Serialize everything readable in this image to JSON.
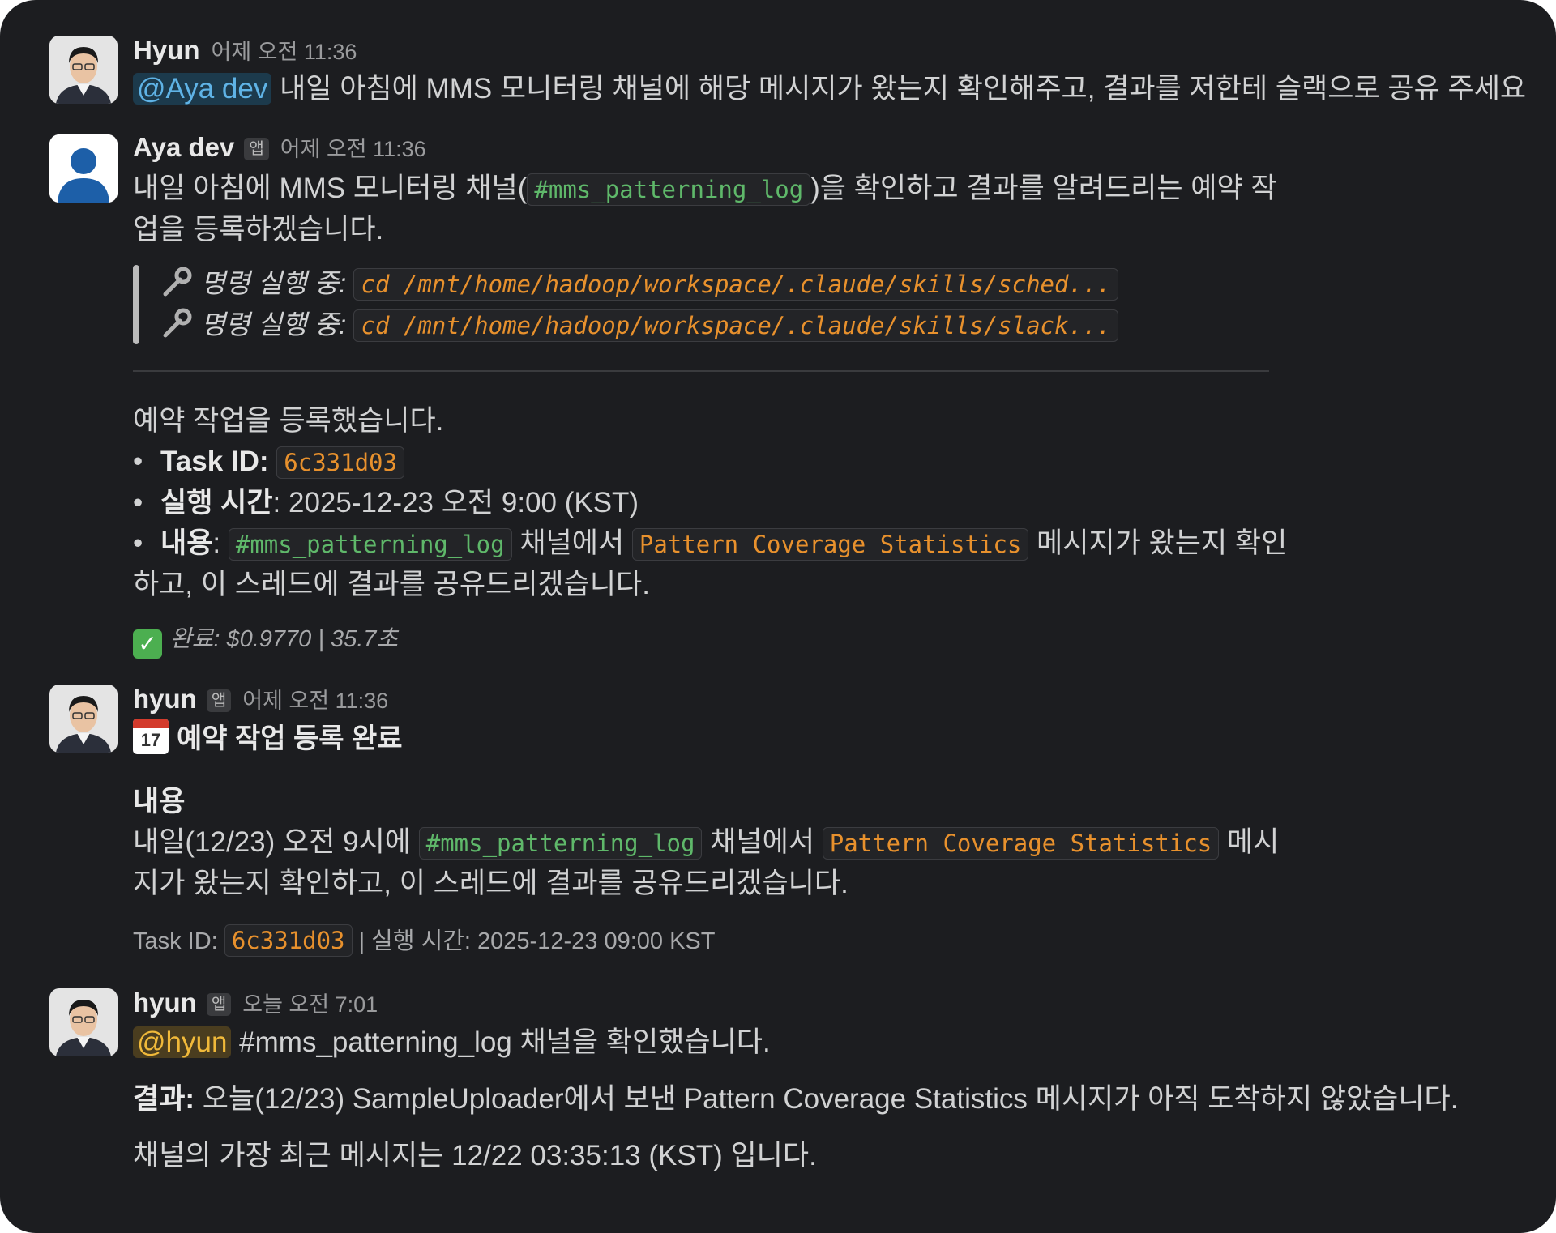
{
  "colors": {
    "background": "#1c1d20",
    "mention_bg": "#1c3a4c",
    "mention_text": "#5fb3e6",
    "code_text": "#e8912d",
    "channel_code_text": "#5fb86a",
    "self_mention_text": "#f0b93a"
  },
  "messages": [
    {
      "user": "Hyun",
      "time": "어제 오전 11:36",
      "avatar": "person-photo",
      "mention": "@Aya dev",
      "text": "내일 아침에 MMS 모니터링 채널에 해당 메시지가 왔는지 확인해주고, 결과를 저한테 슬랙으로 공유 주세요"
    },
    {
      "user": "Aya dev",
      "badge": "앱",
      "time": "어제 오전 11:36",
      "avatar": "user-silhouette-icon",
      "intro_a": "내일 아침에 MMS 모니터링 채널(",
      "intro_channel": "#mms_patterning_log",
      "intro_b": ")을 확인하고 결과를 알려드리는 예약 작",
      "intro_c": "업을 등록하겠습니다.",
      "commands": [
        {
          "label": "명령 실행 중:",
          "code": "cd /mnt/home/hadoop/workspace/.claude/skills/sched..."
        },
        {
          "label": "명령 실행 중:",
          "code": "cd /mnt/home/hadoop/workspace/.claude/skills/slack..."
        }
      ],
      "registered": "예약 작업을 등록했습니다.",
      "task_id_label": "Task ID:",
      "task_id": "6c331d03",
      "exec_label": "실행 시간",
      "exec_value": ": 2025-12-23 오전 9:00 (KST)",
      "content_label": "내용",
      "content_colon": ":",
      "content_channel": "#mms_patterning_log",
      "content_mid": "채널에서",
      "content_code": "Pattern Coverage Statistics",
      "content_after": "메시지가 왔는지 확인",
      "content_line2": "하고, 이 스레드에 결과를 공유드리겠습니다.",
      "done": "완료: $0.9770 | 35.7초"
    },
    {
      "user": "hyun",
      "badge": "앱",
      "time": "어제 오전 11:36",
      "title_num": "17",
      "title": "예약 작업 등록 완료",
      "section": "내용",
      "body_a": "내일(12/23) 오전 9시에",
      "body_channel": "#mms_patterning_log",
      "body_mid": "채널에서",
      "body_code": "Pattern Coverage Statistics",
      "body_after": "메시",
      "body_line2": "지가 왔는지 확인하고, 이 스레드에 결과를 공유드리겠습니다.",
      "footer_label": "Task ID:",
      "footer_id": "6c331d03",
      "footer_rest": "| 실행 시간: 2025-12-23 09:00 KST"
    },
    {
      "user": "hyun",
      "badge": "앱",
      "time": "오늘 오전 7:01",
      "mention": "@hyun",
      "line1": "#mms_patterning_log 채널을 확인했습니다.",
      "result_label": "결과:",
      "result_text": "오늘(12/23) SampleUploader에서 보낸 Pattern Coverage Statistics 메시지가 아직 도착하지 않았습니다.",
      "last_line": "채널의 가장 최근 메시지는 12/22 03:35:13 (KST) 입니다."
    }
  ]
}
